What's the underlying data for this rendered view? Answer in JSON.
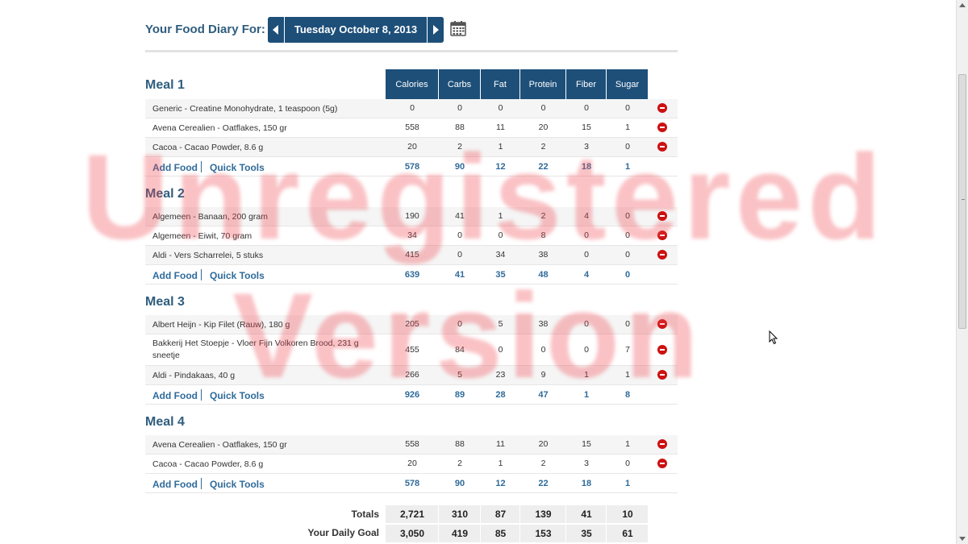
{
  "header": {
    "label": "Your Food Diary For:",
    "date": "Tuesday October 8, 2013",
    "prev_icon": "triangle-left",
    "next_icon": "triangle-right",
    "calendar_icon": "calendar"
  },
  "columns": [
    "Calories",
    "Carbs",
    "Fat",
    "Protein",
    "Fiber",
    "Sugar"
  ],
  "links": {
    "add_food": "Add Food",
    "quick_tools": "Quick Tools"
  },
  "meals": [
    {
      "title": "Meal 1",
      "items": [
        {
          "name": "Generic - Creatine Monohydrate, 1 teaspoon (5g)",
          "values": [
            "0",
            "0",
            "0",
            "0",
            "0",
            "0"
          ]
        },
        {
          "name": "Avena Cerealien - Oatflakes, 150 gr",
          "values": [
            "558",
            "88",
            "11",
            "20",
            "15",
            "1"
          ]
        },
        {
          "name": "Cacoa - Cacao Powder, 8.6 g",
          "values": [
            "20",
            "2",
            "1",
            "2",
            "3",
            "0"
          ]
        }
      ],
      "totals": [
        "578",
        "90",
        "12",
        "22",
        "18",
        "1"
      ]
    },
    {
      "title": "Meal 2",
      "items": [
        {
          "name": "Algemeen - Banaan, 200 gram",
          "values": [
            "190",
            "41",
            "1",
            "2",
            "4",
            "0"
          ]
        },
        {
          "name": "Algemeen - Eiwit, 70 gram",
          "values": [
            "34",
            "0",
            "0",
            "8",
            "0",
            "0"
          ]
        },
        {
          "name": "Aldi - Vers Scharrelei, 5 stuks",
          "values": [
            "415",
            "0",
            "34",
            "38",
            "0",
            "0"
          ]
        }
      ],
      "totals": [
        "639",
        "41",
        "35",
        "48",
        "4",
        "0"
      ]
    },
    {
      "title": "Meal 3",
      "items": [
        {
          "name": "Albert Heijn - Kip Filet (Rauw), 180 g",
          "values": [
            "205",
            "0",
            "5",
            "38",
            "0",
            "0"
          ]
        },
        {
          "name": "Bakkerij Het Stoepje - Vloer Fijn Volkoren Brood, 231 g sneetje",
          "values": [
            "455",
            "84",
            "0",
            "0",
            "0",
            "7"
          ]
        },
        {
          "name": "Aldi - Pindakaas, 40 g",
          "values": [
            "266",
            "5",
            "23",
            "9",
            "1",
            "1"
          ]
        }
      ],
      "totals": [
        "926",
        "89",
        "28",
        "47",
        "1",
        "8"
      ]
    },
    {
      "title": "Meal 4",
      "items": [
        {
          "name": "Avena Cerealien - Oatflakes, 150 gr",
          "values": [
            "558",
            "88",
            "11",
            "20",
            "15",
            "1"
          ]
        },
        {
          "name": "Cacoa - Cacao Powder, 8.6 g",
          "values": [
            "20",
            "2",
            "1",
            "2",
            "3",
            "0"
          ]
        }
      ],
      "totals": [
        "578",
        "90",
        "12",
        "22",
        "18",
        "1"
      ]
    }
  ],
  "totals": {
    "label": "Totals",
    "values": [
      "2,721",
      "310",
      "87",
      "139",
      "41",
      "10"
    ]
  },
  "goal": {
    "label": "Your Daily Goal",
    "values": [
      "3,050",
      "419",
      "85",
      "153",
      "35",
      "61"
    ]
  },
  "watermark": {
    "line1": "Unregistered",
    "line2": "Version"
  },
  "colors": {
    "header_blue": "#1d4f79",
    "title_blue": "#2f5d7e",
    "link_blue": "#2f6b9a",
    "delete_red": "#cc1111"
  }
}
